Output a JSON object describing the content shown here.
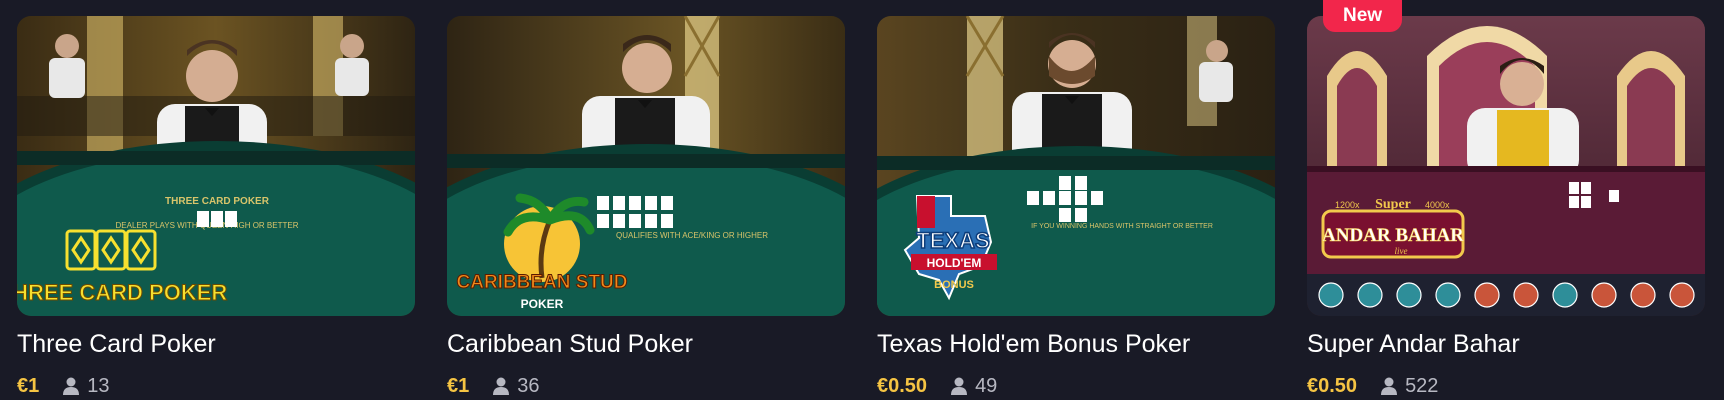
{
  "colors": {
    "page_bg": "#191a26",
    "price": "#f5c443",
    "badge_bg": "#f2264b",
    "title": "#ffffff",
    "count": "#b7b8c2"
  },
  "games": [
    {
      "title": "Three Card Poker",
      "price": "€1",
      "players": "13",
      "badge": "",
      "logo_text": "THREE CARD POKER",
      "table_text": "DEALER PLAYS WITH QUEEN HIGH OR BETTER",
      "table_brand": "THREE CARD POKER"
    },
    {
      "title": "Caribbean Stud Poker",
      "price": "€1",
      "players": "36",
      "badge": "",
      "logo_text": "CARIBBEAN STUD",
      "logo_sub": "POKER",
      "table_text": "QUALIFIES WITH ACE/KING OR HIGHER"
    },
    {
      "title": "Texas Hold'em Bonus Poker",
      "price": "€0.50",
      "players": "49",
      "badge": "",
      "logo_text": "TEXAS",
      "logo_mid": "HOLD'EM",
      "logo_sub": "BONUS",
      "table_text": "IF YOU WINNING HANDS WITH STRAIGHT OR BETTER"
    },
    {
      "title": "Super Andar Bahar",
      "price": "€0.50",
      "players": "522",
      "badge": "New",
      "logo_top": "Super",
      "logo_text": "ANDAR BAHAR",
      "logo_sub": "live",
      "logo_left": "1200x",
      "logo_right": "4000x"
    }
  ]
}
